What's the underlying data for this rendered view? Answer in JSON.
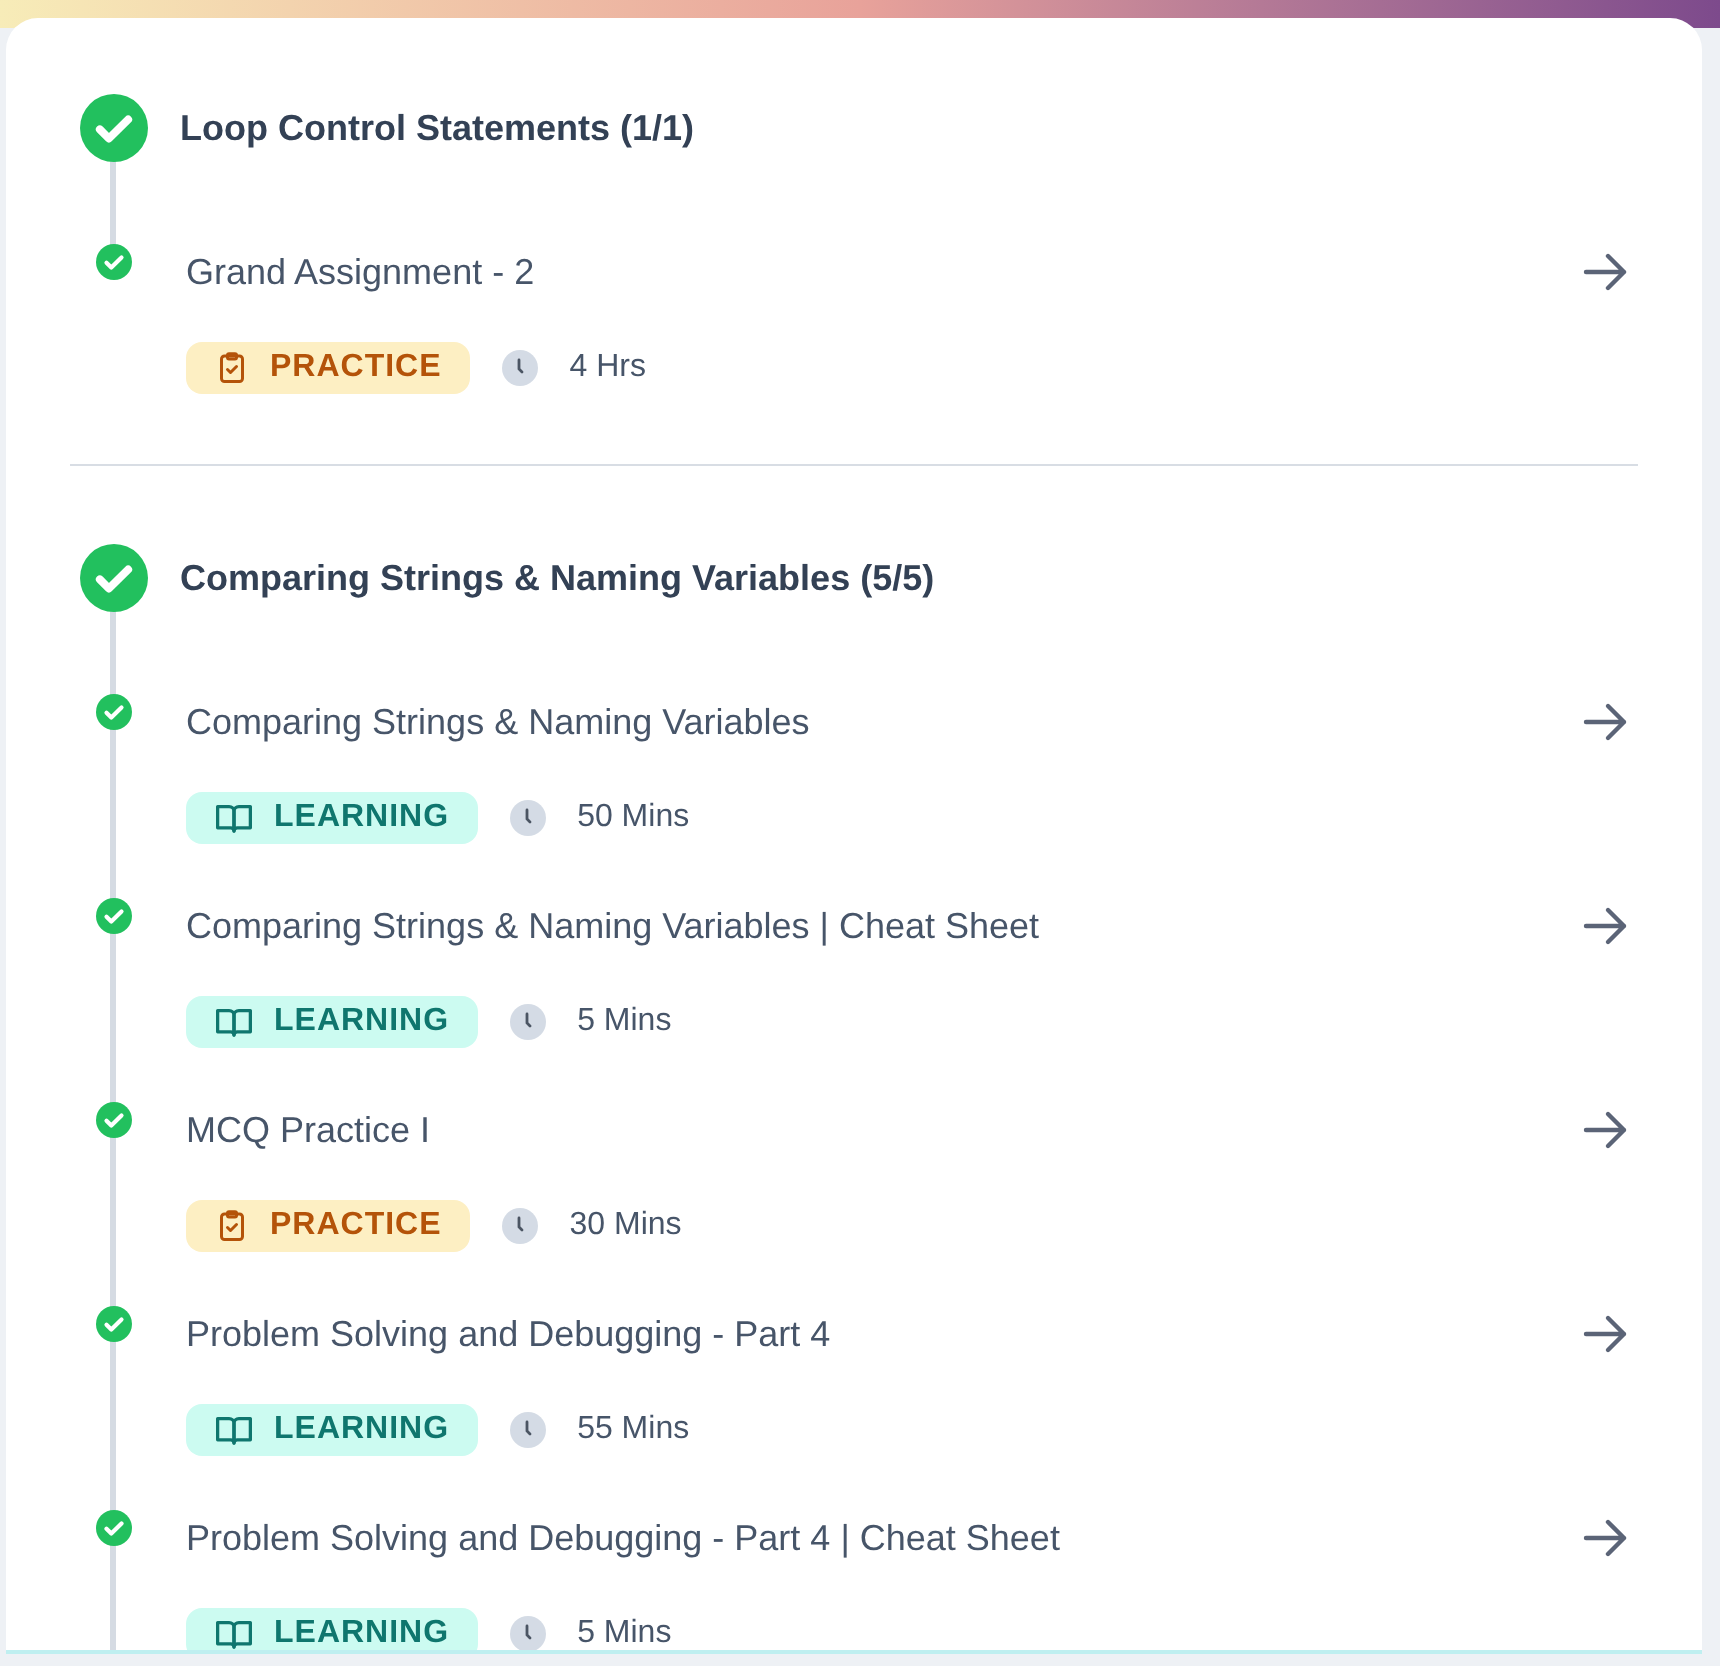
{
  "modules": [
    {
      "title": "Loop Control Statements (1/1)",
      "completed": true,
      "items": [
        {
          "title": "Grand Assignment - 2",
          "completed": true,
          "kind": "practice",
          "tag": "PRACTICE",
          "duration": "4 Hrs"
        }
      ]
    },
    {
      "title": "Comparing Strings & Naming Variables (5/5)",
      "completed": true,
      "items": [
        {
          "title": "Comparing Strings & Naming Variables",
          "completed": true,
          "kind": "learning",
          "tag": "LEARNING",
          "duration": "50 Mins"
        },
        {
          "title": "Comparing Strings & Naming Variables | Cheat Sheet",
          "completed": true,
          "kind": "learning",
          "tag": "LEARNING",
          "duration": "5 Mins"
        },
        {
          "title": "MCQ Practice I",
          "completed": true,
          "kind": "practice",
          "tag": "PRACTICE",
          "duration": "30 Mins"
        },
        {
          "title": "Problem Solving and Debugging - Part 4",
          "completed": true,
          "kind": "learning",
          "tag": "LEARNING",
          "duration": "55 Mins"
        },
        {
          "title": "Problem Solving and Debugging - Part 4 | Cheat Sheet",
          "completed": true,
          "kind": "learning",
          "tag": "LEARNING",
          "duration": "5 Mins"
        }
      ]
    }
  ]
}
